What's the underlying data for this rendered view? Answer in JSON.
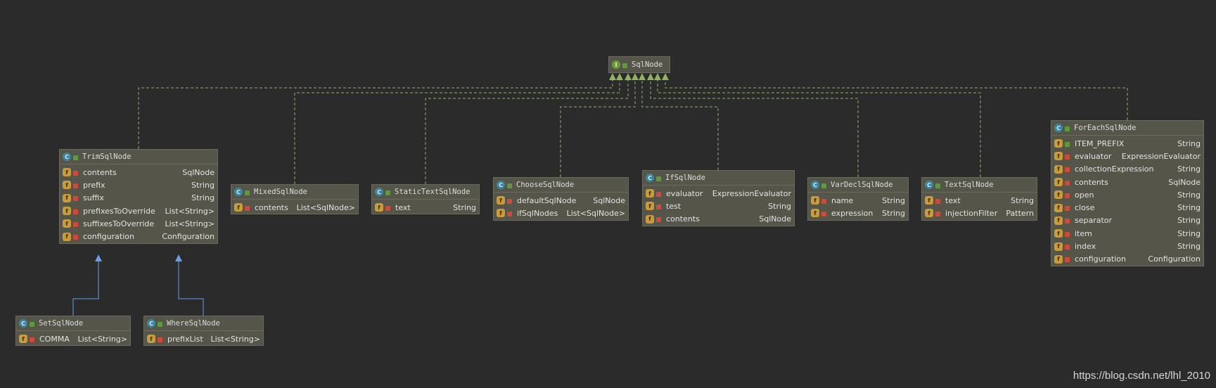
{
  "diagram": {
    "interface": {
      "name": "SqlNode",
      "kind": "I"
    },
    "classes": [
      {
        "id": "trim",
        "name": "TrimSqlNode",
        "fields": [
          {
            "name": "contents",
            "type": "SqlNode"
          },
          {
            "name": "prefix",
            "type": "String"
          },
          {
            "name": "suffix",
            "type": "String"
          },
          {
            "name": "prefixesToOverride",
            "type": "List<String>"
          },
          {
            "name": "suffixesToOverride",
            "type": "List<String>"
          },
          {
            "name": "configuration",
            "type": "Configuration"
          }
        ]
      },
      {
        "id": "mixed",
        "name": "MixedSqlNode",
        "fields": [
          {
            "name": "contents",
            "type": "List<SqlNode>"
          }
        ]
      },
      {
        "id": "static",
        "name": "StaticTextSqlNode",
        "fields": [
          {
            "name": "text",
            "type": "String"
          }
        ]
      },
      {
        "id": "choose",
        "name": "ChooseSqlNode",
        "fields": [
          {
            "name": "defaultSqlNode",
            "type": "SqlNode"
          },
          {
            "name": "ifSqlNodes",
            "type": "List<SqlNode>"
          }
        ]
      },
      {
        "id": "if",
        "name": "IfSqlNode",
        "fields": [
          {
            "name": "evaluator",
            "type": "ExpressionEvaluator"
          },
          {
            "name": "test",
            "type": "String"
          },
          {
            "name": "contents",
            "type": "SqlNode"
          }
        ]
      },
      {
        "id": "vardecl",
        "name": "VarDeclSqlNode",
        "fields": [
          {
            "name": "name",
            "type": "String"
          },
          {
            "name": "expression",
            "type": "String"
          }
        ]
      },
      {
        "id": "text",
        "name": "TextSqlNode",
        "fields": [
          {
            "name": "text",
            "type": "String"
          },
          {
            "name": "injectionFilter",
            "type": "Pattern"
          }
        ]
      },
      {
        "id": "foreach",
        "name": "ForEachSqlNode",
        "fields": [
          {
            "name": "ITEM_PREFIX",
            "type": "String",
            "public": true
          },
          {
            "name": "evaluator",
            "type": "ExpressionEvaluator"
          },
          {
            "name": "collectionExpression",
            "type": "String"
          },
          {
            "name": "contents",
            "type": "SqlNode"
          },
          {
            "name": "open",
            "type": "String"
          },
          {
            "name": "close",
            "type": "String"
          },
          {
            "name": "separator",
            "type": "String"
          },
          {
            "name": "item",
            "type": "String"
          },
          {
            "name": "index",
            "type": "String"
          },
          {
            "name": "configuration",
            "type": "Configuration"
          }
        ]
      },
      {
        "id": "set",
        "name": "SetSqlNode",
        "fields": [
          {
            "name": "COMMA",
            "type": "List<String>"
          }
        ]
      },
      {
        "id": "where",
        "name": "WhereSqlNode",
        "fields": [
          {
            "name": "prefixList",
            "type": "List<String>"
          }
        ]
      }
    ],
    "colors": {
      "background": "#2b2b2b",
      "node_fill": "#55554a",
      "implements_edge": "#8fb35e",
      "extends_edge": "#6a9ee8",
      "class_badge": "#3e86a0",
      "interface_badge": "#6a9c3a",
      "field_badge": "#c89b3c"
    }
  },
  "watermark": "https://blog.csdn.net/lhl_2010"
}
